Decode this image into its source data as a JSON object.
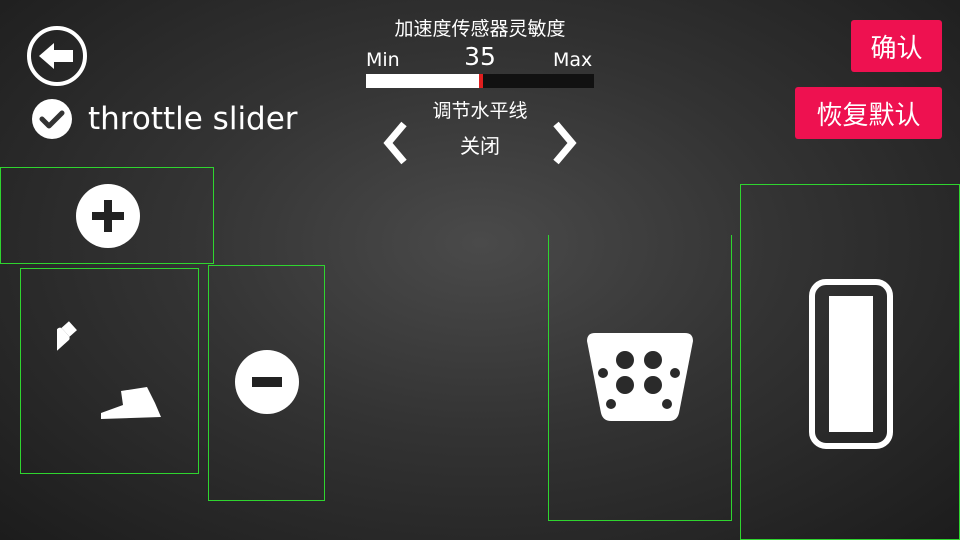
{
  "header": {
    "sensitivity_title": "加速度传感器灵敏度",
    "min_label": "Min",
    "max_label": "Max",
    "sensitivity_value": "35",
    "slider_fraction": 0.5
  },
  "horizon": {
    "title": "调节水平线",
    "value": "关闭"
  },
  "options": {
    "throttle_slider_label": "throttle slider",
    "throttle_slider_checked": true
  },
  "buttons": {
    "confirm_label": "确认",
    "reset_label": "恢复默认"
  },
  "colors": {
    "accent_red": "#ee1150",
    "zone_border": "#2fd52f",
    "slider_fill": "#ffffff",
    "slider_marker": "#e01e1e"
  },
  "icons": {
    "back": "arrow-left-icon",
    "check": "check-circle-icon",
    "prev": "chevron-left-icon",
    "next": "chevron-right-icon",
    "plus": "plus-circle-icon",
    "minus": "minus-circle-icon",
    "handbrake": "handbrake-icon",
    "brake_pedal": "brake-pedal-icon",
    "throttle": "throttle-icon"
  }
}
